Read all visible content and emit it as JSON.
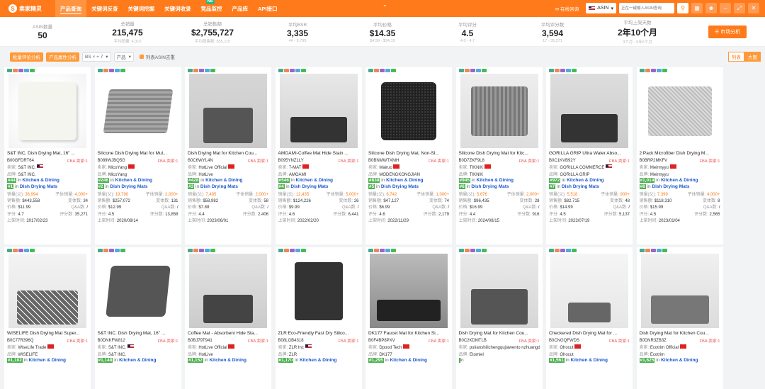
{
  "app": {
    "logo_text": "卖家精灵",
    "nav": [
      {
        "label": "产品查询",
        "active": true
      },
      {
        "label": "关键词反查",
        "active": false
      },
      {
        "label": "关键词挖掘",
        "active": false
      },
      {
        "label": "关键词收录",
        "active": false
      },
      {
        "label": "竞品监控",
        "active": false,
        "badge": "NE"
      },
      {
        "label": "产品库",
        "active": false
      },
      {
        "label": "API接口",
        "active": false
      }
    ],
    "online_support": "在线咨询",
    "search": {
      "type": "ASIN",
      "placeholder": "正在一键输入ASIN查询"
    }
  },
  "stats": [
    {
      "label": "ASIN数量",
      "value": "50",
      "sub": ""
    },
    {
      "label": "总销量",
      "value": "215,475",
      "sub": "平均销量: 4,310"
    },
    {
      "label": "总销售额",
      "value": "$2,755,727",
      "sub": "平均销售额: $55,115"
    },
    {
      "label": "平均BSR",
      "value": "3,335",
      "sub": "44 - 6,795"
    },
    {
      "label": "平均价格",
      "value": "$14.35",
      "sub": "$4.99 - $34.19"
    },
    {
      "label": "平均评分",
      "value": "4.5",
      "sub": "4.0 - 4.7"
    },
    {
      "label": "平均评分数",
      "value": "3,594",
      "sub": "17 - 35,271"
    },
    {
      "label": "平均上架天数",
      "value": "2年10个月",
      "sub": "3个月 - 9年6个月"
    }
  ],
  "market_analysis": "市场分析",
  "toolbar": {
    "btn1": "批量评论分析",
    "btn2": "产品属性分析",
    "select1": "BS × + 7",
    "select2": "产品",
    "dedupe": "列表ASIN去重"
  },
  "view": {
    "list": "列表",
    "grid": "大图"
  },
  "labels": {
    "seller": "卖家:",
    "brand": "品牌:",
    "sales_qty": "销量(父):",
    "sub_sales": "子体销量:",
    "revenue": "销售额:",
    "variants": "变体数:",
    "price": "价格:",
    "qa": "Q&A数:",
    "rating": "评分:",
    "ratings": "评分数:",
    "listed": "上架时间:",
    "in": "in",
    "fba": "FBA",
    "sellers_count": "卖家:"
  },
  "products": [
    {
      "title": "S&T INC. Dish Drying Mat, 16\" ...",
      "asin": "B00GFDRT64",
      "fba": "FBA 卖家:1",
      "seller": "S&T INC.",
      "brand": "S&T INC.",
      "flag": "us",
      "rank1": "#44",
      "cat1": "Kitchen & Dining",
      "rank2": "#1",
      "cat2": "Dish Drying Mats",
      "sales": "36,994",
      "sub": "4,000+",
      "revenue": "$443,558",
      "variants": "34",
      "price": "$11.99",
      "qa": "/",
      "rating": "4.7",
      "ratings": "35,271",
      "date": "2017/02/23"
    },
    {
      "title": "Silicone Dish Drying Mat for Mul...",
      "asin": "B089WJBQ5G",
      "fba": "FBA 卖家:1",
      "seller": "MicoYang",
      "brand": "MicoYang",
      "flag": "cn",
      "rank1": "#246",
      "cat1": "Kitchen & Dining",
      "rank2": "#2",
      "cat2": "Dish Drying Mats",
      "sales": "19,790",
      "sub": "2,000+",
      "revenue": "$257,072",
      "variants": "131",
      "price": "$12.99",
      "qa": "/",
      "rating": "4.5",
      "ratings": "13,858",
      "date": "2020/08/14"
    },
    {
      "title": "Dish Drying Mat for Kitchen Cou...",
      "asin": "B0C6WYL4N",
      "fba": "FBA 卖家:1",
      "seller": "HotLive Official",
      "brand": "HotLive",
      "flag": "cn",
      "rank1": "#428",
      "cat1": "Kitchen & Dining",
      "rank2": "#3",
      "cat2": "Dish Drying Mats",
      "sales": "7,485",
      "sub": "2,000+",
      "revenue": "$58,982",
      "variants": "58",
      "price": "$7.88",
      "qa": "/",
      "rating": "4.4",
      "ratings": "2,406",
      "date": "2023/06/01"
    },
    {
      "title": "AMOAMI-Coffee Mat Hide Stain ...",
      "asin": "B095YNZ1LY",
      "fba": "FBA 卖家:1",
      "seller": "7-MAT",
      "brand": "AMOAMI",
      "flag": "cn",
      "rank1": "#546",
      "cat1": "Kitchen & Dining",
      "rank2": "#4",
      "cat2": "Dish Drying Mats",
      "sales": "12,435",
      "sub": "5,000+",
      "revenue": "$124,226",
      "variants": "26",
      "price": "$9.99",
      "qa": "/",
      "rating": "4.6",
      "ratings": "6,441",
      "date": "2022/02/20"
    },
    {
      "title": "Silicone Dish Drying Mat, Non-Sl...",
      "asin": "B0BNMWTXMH",
      "fba": "FBA 卖家:1",
      "seller": "Mairuo",
      "brand": "MODENGKONGJIAN",
      "flag": "cn",
      "rank1": "#838",
      "cat1": "Kitchen & Dining",
      "rank2": "#5",
      "cat2": "Dish Drying Mats",
      "sales": "6,742",
      "sub": "1,000+",
      "revenue": "$47,127",
      "variants": "74",
      "price": "$6.99",
      "qa": "/",
      "rating": "4.6",
      "ratings": "2,179",
      "date": "2022/11/29"
    },
    {
      "title": "Silicone Dish Drying Mat for Kitc...",
      "asin": "B0D7ZKF9L8",
      "fba": "FBA 卖家:1",
      "seller": "TIKNIK",
      "brand": "TIKNIK",
      "flag": "cn",
      "rank1": "#945",
      "cat1": "Kitchen & Dining",
      "rank2": "#6",
      "cat2": "Dish Drying Mats",
      "sales": "5,676",
      "sub": "2,000+",
      "revenue": "$96,435",
      "variants": "28",
      "price": "$16.99",
      "qa": "/",
      "rating": "4.4",
      "ratings": "916",
      "date": "2024/08/15"
    },
    {
      "title": "GORILLA GRIP Ultra Water Abso...",
      "asin": "B0C1KVB92Y",
      "fba": "FBA 卖家:1",
      "seller": "GORILLA COMMERCE",
      "brand": "GORILLA GRIP",
      "flag": "us",
      "rank1": "#972",
      "cat1": "Kitchen & Dining",
      "rank2": "#7",
      "cat2": "Dish Drying Mats",
      "sales": "5,518",
      "sub": "900+",
      "revenue": "$82,715",
      "variants": "48",
      "price": "$14.99",
      "qa": "/",
      "rating": "4.5",
      "ratings": "5,137",
      "date": "2023/07/19"
    },
    {
      "title": "2 Pack Microfiber Dish Drying M...",
      "asin": "B0BRP2MKFV",
      "fba": "FBA 卖家:1",
      "seller": "Meirmyyu",
      "brand": "Meirmyyu",
      "flag": "cn",
      "rank1": "#1,014",
      "cat1": "Kitchen & Dining",
      "rank2": "#8",
      "cat2": "Dish Drying Mats",
      "sales": "7,399",
      "sub": "4,000+",
      "revenue": "$118,310",
      "variants": "8",
      "price": "$15.99",
      "qa": "/",
      "rating": "4.5",
      "ratings": "2,565",
      "date": "2023/01/04"
    },
    {
      "title": "WISELIFE Dish Drying Mat Super...",
      "asin": "B0C77R396Q",
      "fba": "FBA 卖家:1",
      "seller": "WiseLife Trade",
      "brand": "WISELIFE",
      "flag": "cn",
      "rank1": "#1,102",
      "cat1": "Kitchen & Dining"
    },
    {
      "title": "S&T INC. Dish Drying Mat, 16\" ...",
      "asin": "B0DNKFW812",
      "fba": "FBA 卖家:1",
      "seller": "S&T INC.",
      "brand": "S&T INC.",
      "flag": "us",
      "rank1": "#1,148",
      "cat1": "Kitchen & Dining"
    },
    {
      "title": "Coffee Mat - Absorbent Hide Sta...",
      "asin": "B0BJ79T941",
      "fba": "FBA 卖家:1",
      "seller": "HotLive Official",
      "brand": "HotLive",
      "flag": "cn",
      "rank1": "#1,152",
      "cat1": "Kitchen & Dining"
    },
    {
      "title": "ZLR Eco-Friendly Fast Dry Silico...",
      "asin": "B08LGB4318",
      "fba": "FBA 卖家:1",
      "seller": "ZLR Inc",
      "brand": "ZLR",
      "flag": "us",
      "rank1": "#1,170",
      "cat1": "Kitchen & Dining"
    },
    {
      "title": "DK177 Faucet Mat for Kitchen Si...",
      "asin": "B0F4BP8PXV",
      "fba": "FBA 卖家:1",
      "seller": "Dpood Tech",
      "brand": "DK177",
      "flag": "cn",
      "rank1": "#1,295",
      "cat1": "Kitchen & Dining"
    },
    {
      "title": "Dish Drying Mat for Kitchen Cou...",
      "asin": "B0C2KDMTLB",
      "fba": "FBA 卖家:1",
      "seller": "putianshilichengqujiawento nzhuangdian",
      "brand": "Etomiel",
      "flag": "cn",
      "rank1": "",
      "cat1": ""
    },
    {
      "title": "Checkered Dish Drying Mat for ...",
      "asin": "B0CNGQFWDS",
      "fba": "FBA 卖家:1",
      "seller": "Ohocut",
      "brand": "Ohocut",
      "flag": "cn",
      "rank1": "#1,561",
      "cat1": "Kitchen & Dining"
    },
    {
      "title": "Dish Drying Mat for Kitchen Cou...",
      "asin": "B0DNR3ZB3Z",
      "fba": "FBA 卖家:1",
      "seller": "Ecotrim Official",
      "brand": "Ecotrim",
      "flag": "cn",
      "rank1": "#1,625",
      "cat1": "Kitchen & Dining"
    }
  ],
  "colors": {
    "accent": "#ff7a1a",
    "link": "#1a56c9",
    "rank_bg": "#4caf50"
  }
}
